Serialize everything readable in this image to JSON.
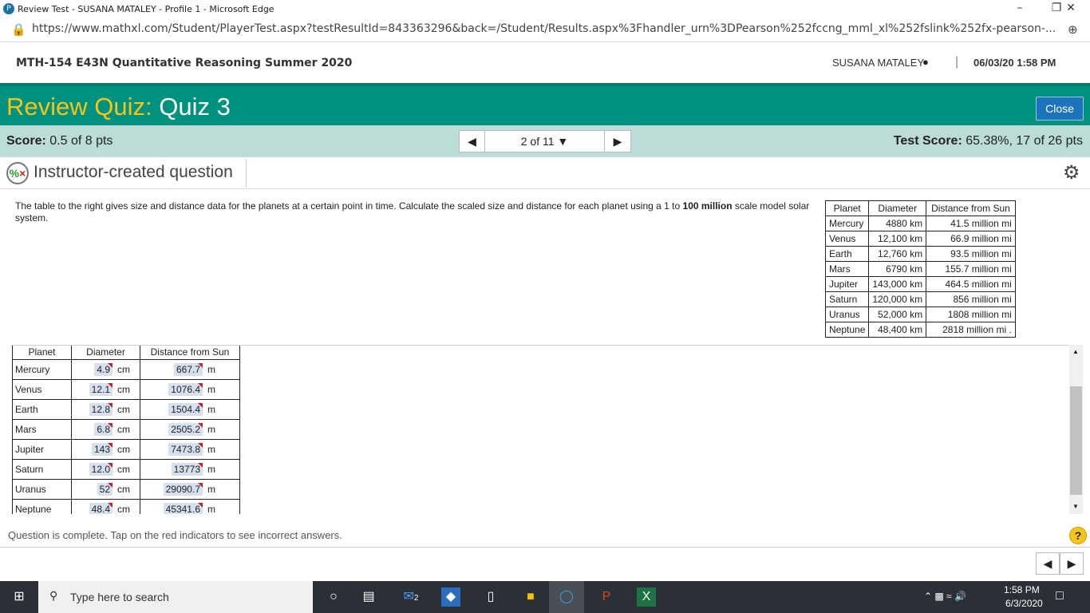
{
  "browser": {
    "title": "Review Test - SUSANA MATALEY - Profile 1 - Microsoft Edge",
    "url": "https://www.mathxl.com/Student/PlayerTest.aspx?testResultId=843363296&back=/Student/Results.aspx%3Fhandler_urn%3DPearson%252fccng_mml_xl%252fslink%252fx-pearson-..."
  },
  "course": {
    "name": "MTH-154 E43N Quantitative Reasoning Summer 2020",
    "user": "SUSANA MATALEY",
    "datetime": "06/03/20 1:58 PM"
  },
  "banner": {
    "prefix": "Review Quiz:",
    "title": "Quiz 3",
    "close": "Close"
  },
  "score": {
    "label": "Score:",
    "value": "0.5 of 8 pts",
    "nav": "2 of 11",
    "test_label": "Test Score:",
    "test_value": "65.38%, 17 of 26 pts"
  },
  "question": {
    "title": "Instructor-created question",
    "prompt_a": "The table to the right gives size and distance data for the planets at a certain point in time. Calculate the scaled size and distance for each planet using a 1 to ",
    "prompt_bold": "100 million",
    "prompt_b": " scale model solar system."
  },
  "given_table": {
    "headers": [
      "Planet",
      "Diameter",
      "Distance from Sun"
    ],
    "rows": [
      [
        "Mercury",
        "4880 km",
        "41.5 million mi"
      ],
      [
        "Venus",
        "12,100 km",
        "66.9 million mi"
      ],
      [
        "Earth",
        "12,760 km",
        "93.5 million mi"
      ],
      [
        "Mars",
        "6790 km",
        "155.7 million mi"
      ],
      [
        "Jupiter",
        "143,000 km",
        "464.5 million mi"
      ],
      [
        "Saturn",
        "120,000 km",
        "856 million mi"
      ],
      [
        "Uranus",
        "52,000 km",
        "1808 million mi"
      ],
      [
        "Neptune",
        "48,400 km",
        "2818 million mi ."
      ]
    ]
  },
  "answer_table": {
    "headers": [
      "Planet",
      "Diameter",
      "Distance from Sun"
    ],
    "unit_d": "cm",
    "unit_s": "m",
    "rows": [
      [
        "Mercury",
        "4.9",
        "667.7"
      ],
      [
        "Venus",
        "12.1",
        "1076.4"
      ],
      [
        "Earth",
        "12.8",
        "1504.4"
      ],
      [
        "Mars",
        "6.8",
        "2505.2"
      ],
      [
        "Jupiter",
        "143",
        "7473.8"
      ],
      [
        "Saturn",
        "12.0",
        "13773"
      ],
      [
        "Uranus",
        "52",
        "29090.7"
      ],
      [
        "Neptune",
        "48.4",
        "45341.6"
      ]
    ]
  },
  "status": "Question is complete. Tap on the red indicators to see incorrect answers.",
  "taskbar": {
    "search": "Type here to search",
    "time": "1:58 PM",
    "date": "6/3/2020",
    "mail_badge": "2"
  },
  "colors": {
    "teal": "#00917f",
    "quiz_yellow": "#f5c518",
    "score_bar": "#bcdcd7",
    "close_btn": "#1e73be",
    "incorrect": "#c0252a"
  }
}
